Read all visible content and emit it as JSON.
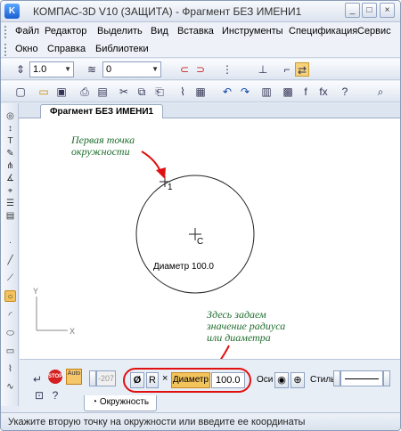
{
  "window": {
    "title": "КОМПАС-3D V10 (ЗАЩИТА) - Фрагмент БЕЗ ИМЕНИ1",
    "icon": "kompas-app-icon"
  },
  "menu": {
    "row1": [
      "Файл",
      "Редактор",
      "Выделить",
      "Вид",
      "Вставка",
      "Инструменты",
      "Спецификация",
      "Сервис"
    ],
    "row2": [
      "Окно",
      "Справка",
      "Библиотеки"
    ]
  },
  "toolbar1": {
    "scale_value": "1.0",
    "layer_value": "0"
  },
  "document": {
    "tab_label": "Фрагмент БЕЗ ИМЕНИ1"
  },
  "drawing": {
    "point1_label": "1",
    "center_label": "C",
    "diameter_label": "Диаметр 100.0",
    "axis_y": "Y",
    "axis_x": "X"
  },
  "annotations": {
    "top_line1": "Первая точка",
    "top_line2": "окружности",
    "bottom_line1": "Здесь задаем",
    "bottom_line2": "значение радиуса",
    "bottom_line3": "или диаметра",
    "arrow_color": "#e01010",
    "text_color": "#1f6e2e"
  },
  "property_bar": {
    "coord_value": "-207",
    "r_label": "R",
    "diameter_label": "Диаметр",
    "diameter_value": "100.0",
    "axes_label": "Оси",
    "style_label": "Стиль",
    "tab_label": "Окружность",
    "auto_label": "Auto",
    "stop_label": "STOP"
  },
  "status": {
    "text": "Укажите вторую точку на окружности или введите ее координаты"
  },
  "window_controls": {
    "minimize": "_",
    "maximize": "□",
    "close": "×"
  },
  "accent": "#1a5fd0"
}
